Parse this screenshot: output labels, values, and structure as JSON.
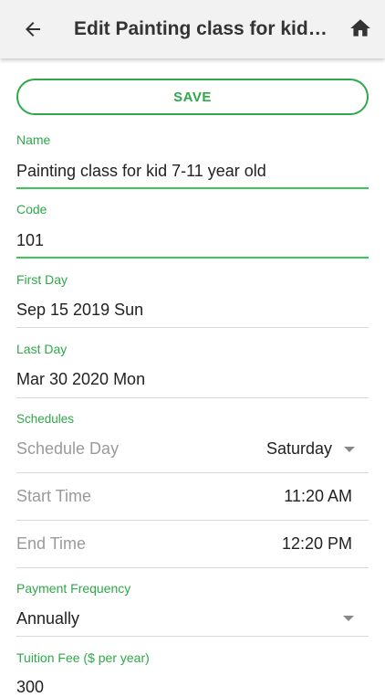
{
  "appbar": {
    "title": "Edit Painting class for kid ...",
    "back_icon": "arrow-back-icon",
    "home_icon": "home-icon"
  },
  "save_label": "SAVE",
  "fields": {
    "name": {
      "label": "Name",
      "value": "Painting class for kid 7-11 year old"
    },
    "code": {
      "label": "Code",
      "value": "101"
    },
    "first_day": {
      "label": "First Day",
      "value": "Sep 15 2019 Sun"
    },
    "last_day": {
      "label": "Last Day",
      "value": "Mar 30 2020 Mon"
    }
  },
  "schedules": {
    "label": "Schedules",
    "schedule_day": {
      "label": "Schedule Day",
      "value": "Saturday"
    },
    "start_time": {
      "label": "Start Time",
      "value": "11:20 AM"
    },
    "end_time": {
      "label": "End Time",
      "value": "12:20 PM"
    }
  },
  "payment_frequency": {
    "label": "Payment Frequency",
    "value": "Annually"
  },
  "tuition_fee": {
    "label": "Tuition Fee ($ per year)",
    "value": "300"
  },
  "colors": {
    "accent": "#2ea84a",
    "active_underline": "#3cc75a"
  }
}
